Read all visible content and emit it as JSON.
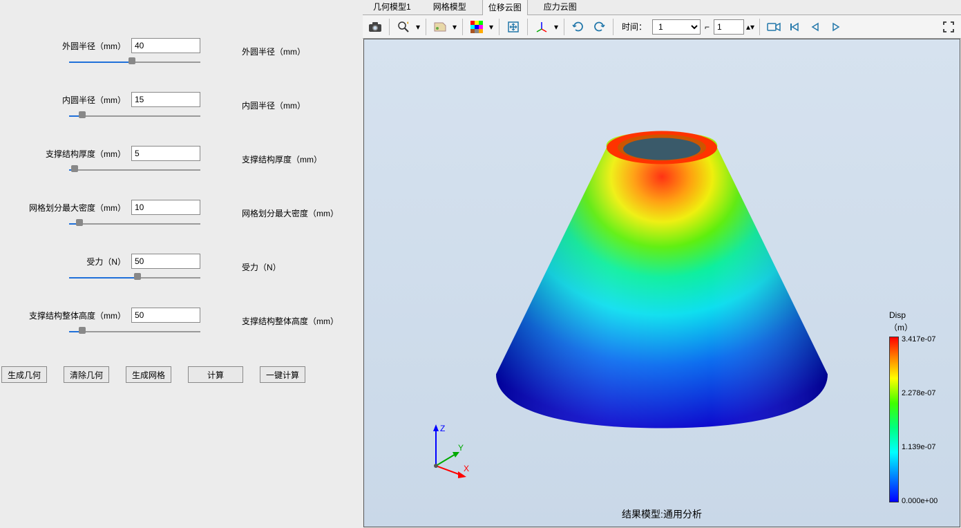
{
  "params": [
    {
      "label": "外圆半径（mm）",
      "value": "40",
      "right": "外圆半径（mm）",
      "fill": 48
    },
    {
      "label": "内圆半径（mm）",
      "value": "15",
      "right": "内圆半径（mm）",
      "fill": 10
    },
    {
      "label": "支撑结构厚度（mm）",
      "value": "5",
      "right": "支撑结构厚度（mm）",
      "fill": 4
    },
    {
      "label": "网格划分最大密度（mm）",
      "value": "10",
      "right": "网格划分最大密度（mm）",
      "fill": 8
    },
    {
      "label": "受力（N）",
      "value": "50",
      "right": "受力（N）",
      "fill": 52
    },
    {
      "label": "支撑结构整体高度（mm）",
      "value": "50",
      "right": "支撑结构整体高度（mm）",
      "fill": 10
    }
  ],
  "buttons": {
    "gen_geom": "生成几何",
    "clear_geom": "清除几何",
    "gen_mesh": "生成网格",
    "compute": "计算",
    "one_click": "一键计算"
  },
  "tabs": [
    "几何模型1",
    "网格模型",
    "位移云图",
    "应力云图"
  ],
  "active_tab": 2,
  "toolbar": {
    "time_label": "时间：",
    "time_value": "1",
    "frame_value": "1"
  },
  "legend": {
    "title_line1": "Disp",
    "title_line2": "（m）",
    "ticks": [
      "3.417e-07",
      "2.278e-07",
      "1.139e-07",
      "0.000e+00"
    ]
  },
  "result_title": "结果模型:通用分析",
  "triad": {
    "x": "X",
    "y": "Y",
    "z": "Z"
  }
}
